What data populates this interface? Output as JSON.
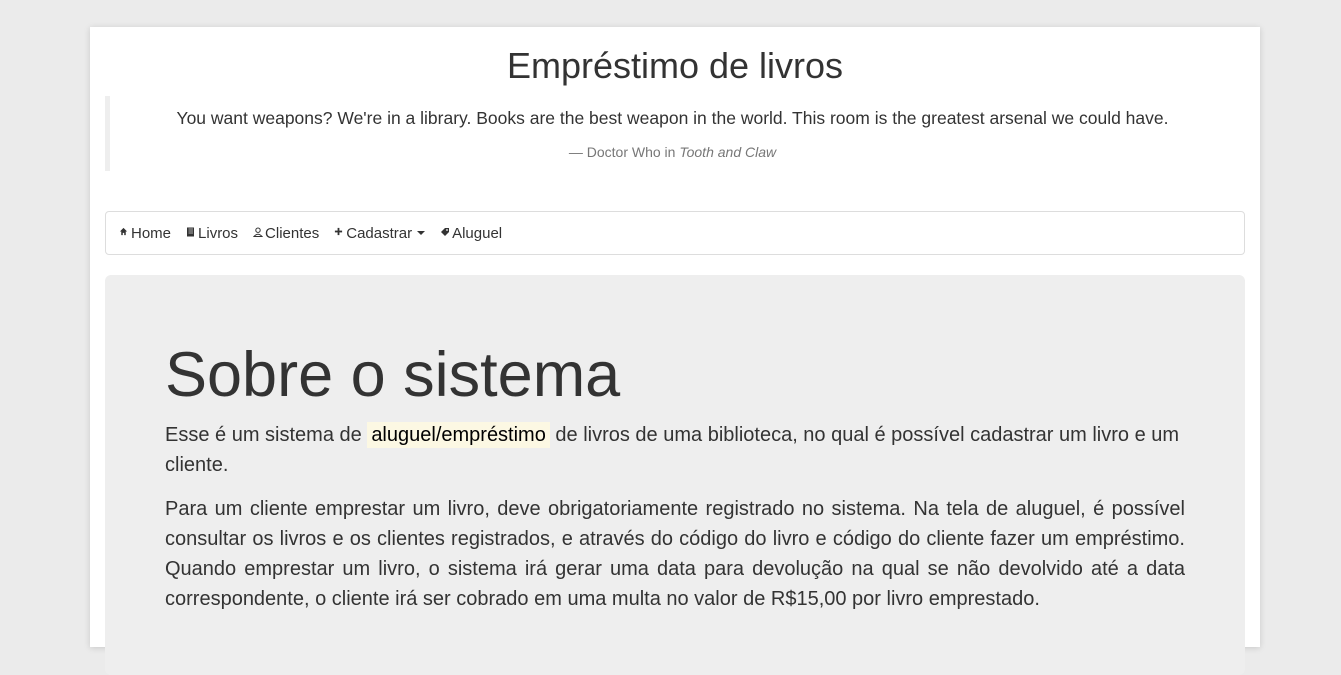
{
  "header": {
    "title": "Empréstimo de livros",
    "quote": "You want weapons? We're in a library. Books are the best weapon in the world. This room is the greatest arsenal we could have.",
    "quote_prefix": "— Doctor Who in ",
    "quote_work": "Tooth and Claw"
  },
  "nav": {
    "items": [
      {
        "label": "Home",
        "icon": "home-icon"
      },
      {
        "label": "Livros",
        "icon": "book-icon"
      },
      {
        "label": "Clientes",
        "icon": "user-icon"
      },
      {
        "label": "Cadastrar",
        "icon": "plus-icon"
      },
      {
        "label": "Aluguel",
        "icon": "tag-icon"
      }
    ]
  },
  "about": {
    "title": "Sobre o sistema",
    "para1_before": "Esse é um sistema de ",
    "para1_highlight": "aluguel/empréstimo",
    "para1_after": " de livros de uma biblioteca, no qual é possível cadastrar um livro e um cliente.",
    "para2": "Para um cliente emprestar um livro, deve obrigatoriamente registrado no sistema. Na tela de aluguel, é possível consultar os livros e os clientes registrados, e através do código do livro e código do cliente fazer um empréstimo. Quando emprestar um livro, o sistema irá gerar uma data para devolução na qual se não devolvido até a data correspondente, o cliente irá ser cobrado em uma multa no valor de R$15,00 por livro emprestado."
  },
  "colors": {
    "background": "#ebebeb",
    "jumbotron": "#eeeeee",
    "highlight": "#fcf8e3"
  }
}
